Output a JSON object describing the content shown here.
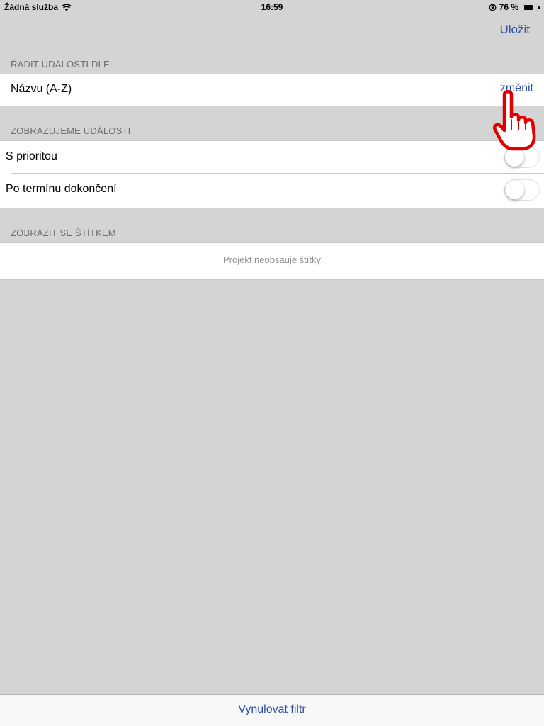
{
  "status_bar": {
    "carrier": "Žádná služba",
    "time": "16:59",
    "battery": "76 %",
    "battery_level": 0.76,
    "icons": [
      "wifi-icon",
      "rotation-lock-icon",
      "battery-icon"
    ]
  },
  "nav": {
    "save_label": "Uložit"
  },
  "sort_section": {
    "header": "ŘADIT UDÁLOSTI DLE",
    "value": "Názvu (A-Z)",
    "action": "změnit"
  },
  "display_section": {
    "header": "ZOBRAZUJEME UDÁLOSTI",
    "rows": [
      {
        "label": "S prioritou",
        "enabled": false
      },
      {
        "label": "Po termínu dokončení",
        "enabled": false
      }
    ]
  },
  "tag_section": {
    "header": "ZOBRAZIT SE ŠTÍTKEM",
    "empty_text": "Projekt neobsauje štítky"
  },
  "bottom": {
    "reset_label": "Vynulovat filtr"
  },
  "colors": {
    "accent": "#2d4ea6",
    "background": "#d4d4d4",
    "pointer_outline": "#e00000"
  }
}
